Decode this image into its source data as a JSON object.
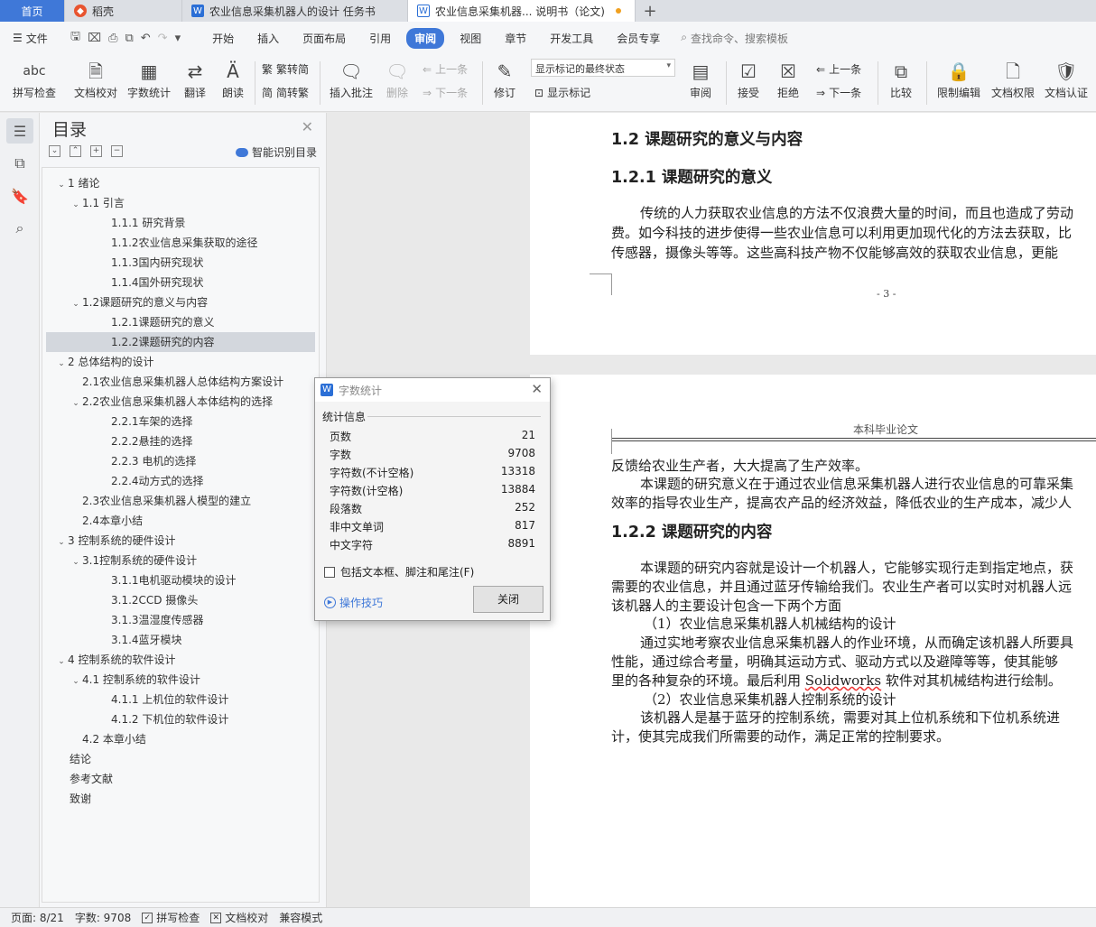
{
  "tabs": {
    "home": "首页",
    "daoke": "稻壳",
    "doc1": "农业信息采集机器人的设计 任务书",
    "doc2": "农业信息采集机器... 说明书（论文)",
    "add": "+"
  },
  "menubar": {
    "file": "文件",
    "items": [
      "开始",
      "插入",
      "页面布局",
      "引用",
      "审阅",
      "视图",
      "章节",
      "开发工具",
      "会员专享"
    ],
    "active_index": 4,
    "search": "查找命令、搜索模板"
  },
  "ribbon": {
    "spellcheck": "拼写检查",
    "doccheck": "文档校对",
    "wordcount": "字数统计",
    "translate": "翻译",
    "read": "朗读",
    "trad": "繁转简",
    "simp": "简转繁",
    "insert_comment": "插入批注",
    "delete": "删除",
    "prev1": "上一条",
    "next1": "下一条",
    "revise": "修订",
    "markup_select": "显示标记的最终状态",
    "show_markup": "显示标记",
    "review": "审阅",
    "accept": "接受",
    "reject": "拒绝",
    "prev2": "上一条",
    "next2": "下一条",
    "compare": "比较",
    "restrict": "限制编辑",
    "doc_permission": "文档权限",
    "doc_cert": "文档认证"
  },
  "toc": {
    "title": "目录",
    "smart": "智能识别目录",
    "items": [
      {
        "text": "1  绪论",
        "level": 1,
        "toggle": true
      },
      {
        "text": "1.1  引言",
        "level": 2,
        "toggle": true
      },
      {
        "text": "1.1.1  研究背景",
        "level": 3
      },
      {
        "text": "1.1.2农业信息采集获取的途径",
        "level": 3
      },
      {
        "text": "1.1.3国内研究现状",
        "level": 3
      },
      {
        "text": "1.1.4国外研究现状",
        "level": 3
      },
      {
        "text": "1.2课题研究的意义与内容",
        "level": 2,
        "toggle": true
      },
      {
        "text": "1.2.1课题研究的意义",
        "level": 3
      },
      {
        "text": "1.2.2课题研究的内容",
        "level": 3,
        "selected": true
      },
      {
        "text": "2  总体结构的设计",
        "level": 1,
        "toggle": true
      },
      {
        "text": "2.1农业信息采集机器人总体结构方案设计",
        "level": 2
      },
      {
        "text": "2.2农业信息采集机器人本体结构的选择",
        "level": 2,
        "toggle": true
      },
      {
        "text": "2.2.1车架的选择",
        "level": 3
      },
      {
        "text": "2.2.2悬挂的选择",
        "level": 3
      },
      {
        "text": "2.2.3  电机的选择",
        "level": 3
      },
      {
        "text": "2.2.4动方式的选择",
        "level": 3
      },
      {
        "text": "2.3农业信息采集机器人模型的建立",
        "level": 2
      },
      {
        "text": "2.4本章小结",
        "level": 2
      },
      {
        "text": "3  控制系统的硬件设计",
        "level": 1,
        "toggle": true
      },
      {
        "text": "3.1控制系统的硬件设计",
        "level": 2,
        "toggle": true
      },
      {
        "text": "3.1.1电机驱动模块的设计",
        "level": 3
      },
      {
        "text": "3.1.2CCD 摄像头",
        "level": 3
      },
      {
        "text": "3.1.3温湿度传感器",
        "level": 3
      },
      {
        "text": "3.1.4蓝牙模块",
        "level": 3
      },
      {
        "text": "4  控制系统的软件设计",
        "level": 1,
        "toggle": true
      },
      {
        "text": "4.1 控制系统的软件设计",
        "level": 2,
        "toggle": true
      },
      {
        "text": "4.1.1 上机位的软件设计",
        "level": 3
      },
      {
        "text": "4.1.2 下机位的软件设计",
        "level": 3
      },
      {
        "text": "4.2 本章小结",
        "level": 2
      },
      {
        "text": "结论",
        "level": 0
      },
      {
        "text": "参考文献",
        "level": 0
      },
      {
        "text": "致谢",
        "level": 0
      }
    ]
  },
  "document": {
    "page1": {
      "h1": "1.2  课题研究的意义与内容",
      "h2": "1.2.1  课题研究的意义",
      "lines": [
        "传统的人力获取农业信息的方法不仅浪费大量的时间，而且也造成了劳动",
        "费。如今科技的进步使得一些农业信息可以利用更加现代化的方法去获取，比",
        "传感器，摄像头等等。这些高科技产物不仅能够高效的获取农业信息，更能"
      ],
      "page_number": "- 3 -"
    },
    "page2": {
      "header": "本科毕业论文",
      "lines_a": [
        "反馈给农业生产者，大大提高了生产效率。",
        "本课题的研究意义在于通过农业信息采集机器人进行农业信息的可靠采集",
        "效率的指导农业生产，提高农产品的经济效益，降低农业的生产成本，减少人"
      ],
      "h2": "1.2.2  课题研究的内容",
      "lines_b": [
        "本课题的研究内容就是设计一个机器人，它能够实现行走到指定地点，获",
        "需要的农业信息，并且通过蓝牙传输给我们。农业生产者可以实时对机器人远",
        "该机器人的主要设计包含一下两个方面",
        "（1）农业信息采集机器人机械结构的设计",
        "通过实地考察农业信息采集机器人的作业环境，从而确定该机器人所要具",
        "性能，通过综合考量，明确其运动方式、驱动方式以及避障等等，使其能够",
        "里的各种复杂的环境。最后利用 ",
        "Solidworks",
        " 软件对其机械结构进行绘制。",
        "（2）农业信息采集机器人控制系统的设计",
        "该机器人是基于蓝牙的控制系统，需要对其上位机系统和下位机系统进",
        "计，使其完成我们所需要的动作，满足正常的控制要求。"
      ]
    }
  },
  "dialog": {
    "title": "字数统计",
    "section": "统计信息",
    "stats": [
      {
        "label": "页数",
        "value": "21"
      },
      {
        "label": "字数",
        "value": "9708"
      },
      {
        "label": "字符数(不计空格)",
        "value": "13318"
      },
      {
        "label": "字符数(计空格)",
        "value": "13884"
      },
      {
        "label": "段落数",
        "value": "252"
      },
      {
        "label": "非中文单词",
        "value": "817"
      },
      {
        "label": "中文字符",
        "value": "8891"
      }
    ],
    "checkbox": "包括文本框、脚注和尾注(F)",
    "tips": "操作技巧",
    "close": "关闭"
  },
  "status": {
    "page": "页面: 8/21",
    "words": "字数: 9708",
    "spell": "拼写检查",
    "doccheck": "文档校对",
    "compat": "兼容模式"
  }
}
